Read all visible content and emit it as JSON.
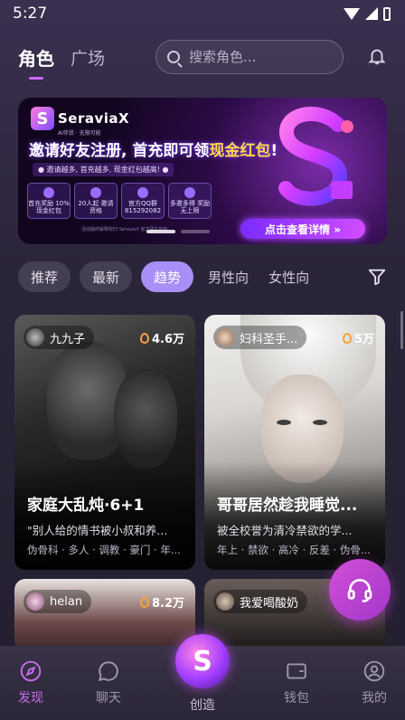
{
  "status_bar": {
    "time": "5:27"
  },
  "header": {
    "tab_active": "角色",
    "tab_inactive": "广场",
    "search_placeholder": "搜索角色..."
  },
  "banner": {
    "brand_name": "SeraviaX",
    "brand_tagline": "AI伴侣 · 无限可能",
    "headline_part1": "邀请好友注册, 首充即可领",
    "headline_highlight": "现金红包",
    "headline_end": "!",
    "subline": "● 邀请越多, 首充越多, 现金红包越高! ●",
    "perks": [
      "首充奖励 10% 现金红包",
      "20人起 邀请资格",
      "官方QQ群 815292082",
      "多邀多得 奖励无上限"
    ],
    "footnote": "活动最终解释权归 SeraviaX 官方团队所有",
    "cta": "点击查看详情 »"
  },
  "filters": {
    "chips": [
      "推荐",
      "最新",
      "趋势",
      "男性向",
      "女性向"
    ],
    "active": "趋势"
  },
  "cards": [
    {
      "creator": "九九子",
      "popularity": "4.6万",
      "title": "家庭大乱炖·6+1",
      "description": "\"别人给的情书被小叔和养...",
      "tags": "伪骨科 · 多人 · 调教 · 豪门 · 年..."
    },
    {
      "creator": "妇科圣手...",
      "popularity": "5万",
      "title": "哥哥居然趁我睡觉...",
      "description": "被全校誉为清冷禁欲的学...",
      "tags": "年上 · 禁欲 · 高冷 · 反差 · 伪骨..."
    },
    {
      "creator": "helan",
      "popularity": "8.2万"
    },
    {
      "creator": "我爱喝酸奶",
      "popularity": ""
    }
  ],
  "tabbar": {
    "discover": "发现",
    "chat": "聊天",
    "create": "创造",
    "wallet": "钱包",
    "mine": "我的"
  },
  "colors": {
    "accent": "#c46ee8",
    "active_chip": "#a98ef5"
  }
}
